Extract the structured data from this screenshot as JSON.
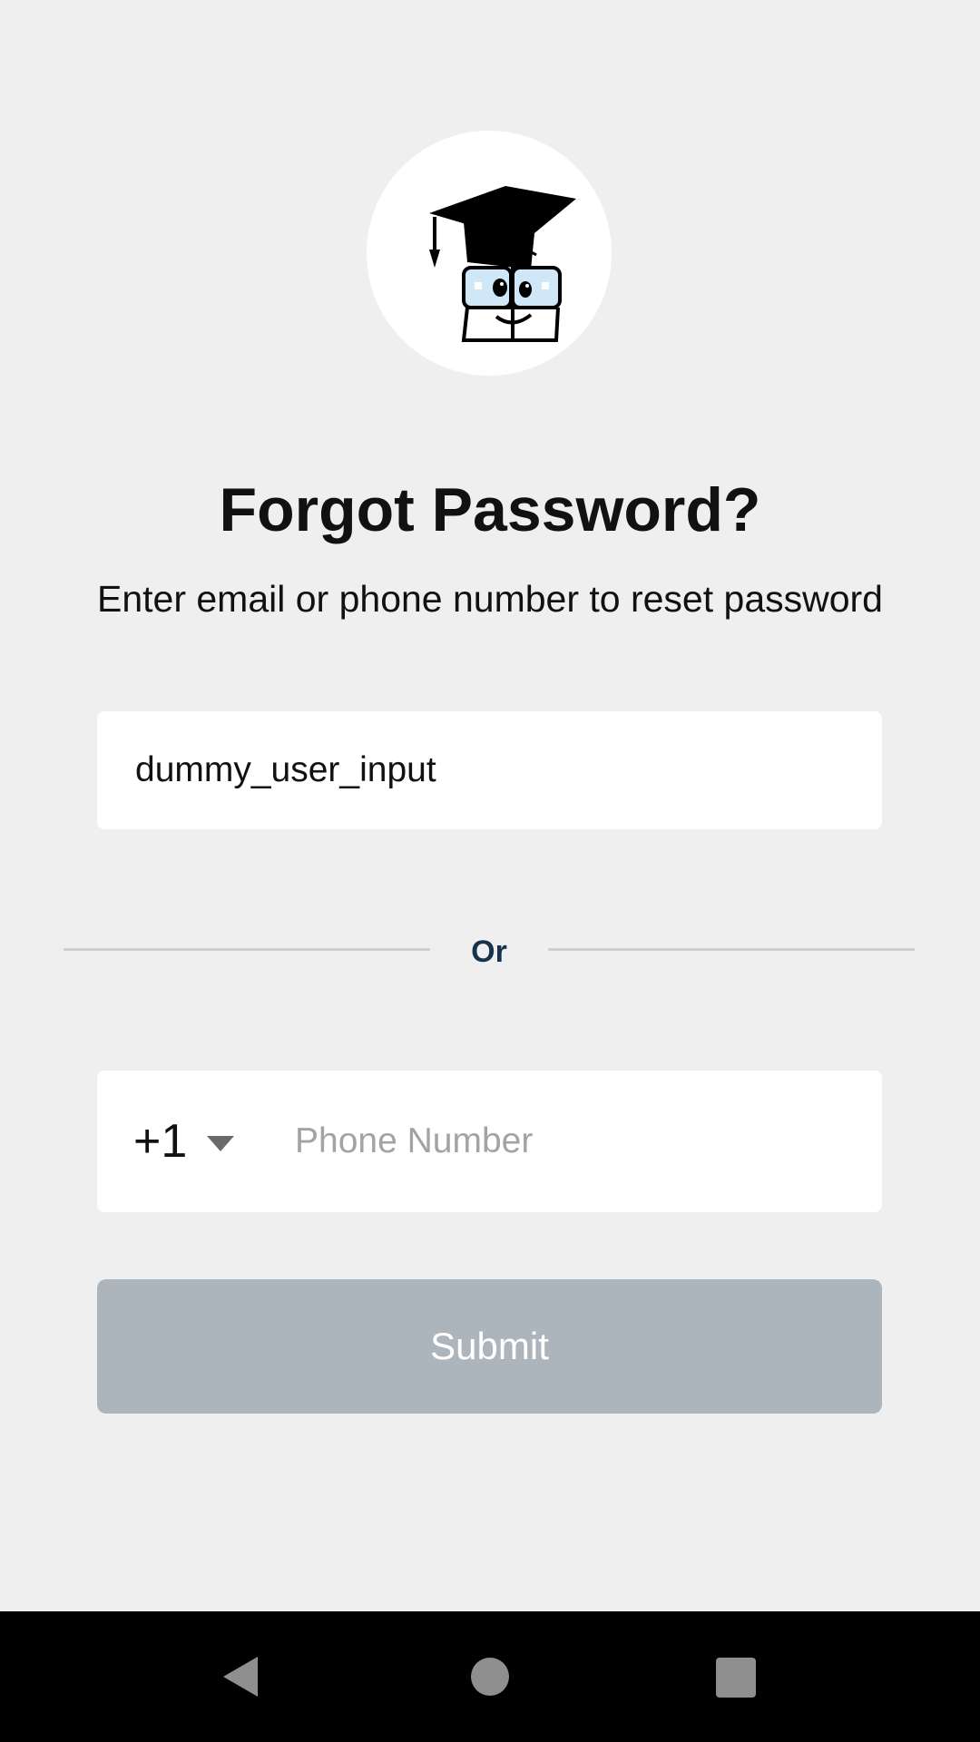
{
  "logo": {
    "icon": "graduation-cap-mascot-logo"
  },
  "header": {
    "title": "Forgot Password?",
    "subtitle": "Enter email or phone number to reset password"
  },
  "email_field": {
    "value": "dummy_user_input"
  },
  "divider": {
    "label": "Or"
  },
  "phone_field": {
    "country_code": "+1",
    "placeholder": "Phone Number",
    "value": ""
  },
  "submit": {
    "label": "Submit",
    "enabled": false
  },
  "system_nav": {
    "back_icon": "triangle-back-icon",
    "home_icon": "circle-home-icon",
    "recents_icon": "square-recents-icon"
  },
  "colors": {
    "background": "#efefef",
    "submit_disabled": "#adb5bc",
    "divider_text": "#17324d",
    "navbar": "#000000"
  }
}
